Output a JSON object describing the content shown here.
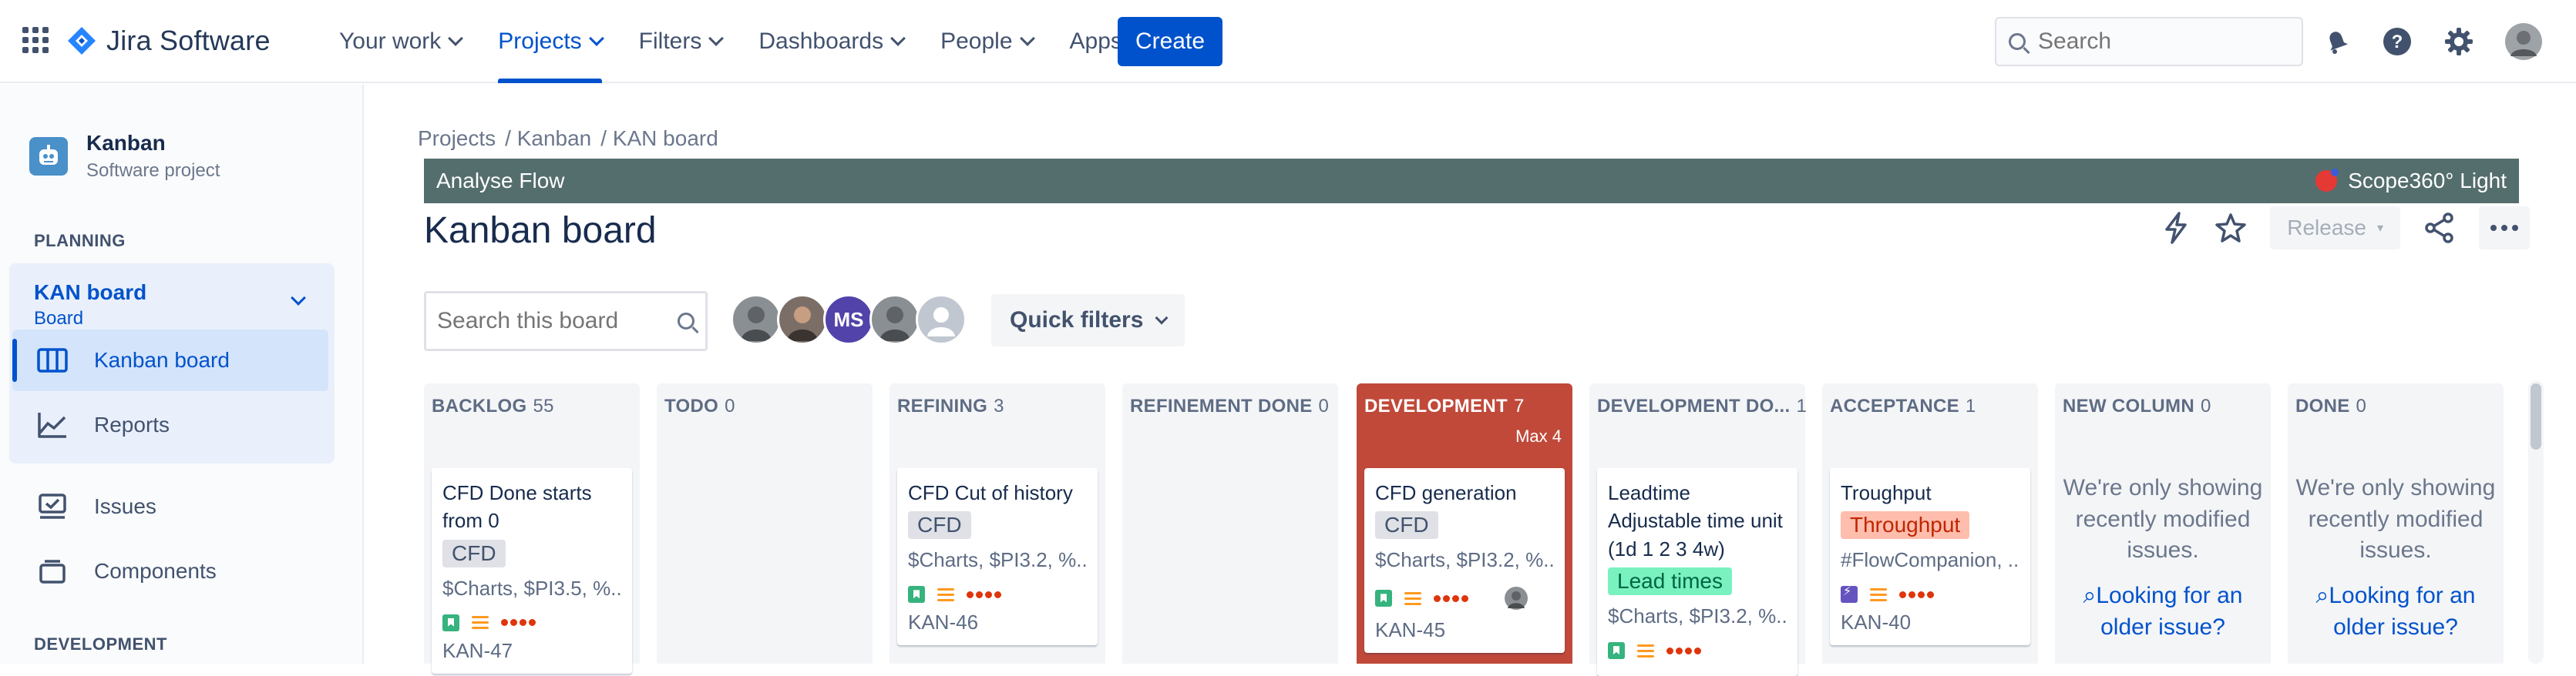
{
  "app": {
    "product": "Jira Software"
  },
  "nav": {
    "items": [
      {
        "label": "Your work",
        "active": false
      },
      {
        "label": "Projects",
        "active": true
      },
      {
        "label": "Filters",
        "active": false
      },
      {
        "label": "Dashboards",
        "active": false
      },
      {
        "label": "People",
        "active": false
      },
      {
        "label": "Apps",
        "active": false
      }
    ],
    "create_label": "Create",
    "search_placeholder": "Search"
  },
  "sidebar": {
    "project_name": "Kanban",
    "project_type": "Software project",
    "planning_heading": "PLANNING",
    "board_name": "KAN board",
    "board_sub": "Board",
    "items": [
      {
        "label": "Kanban board",
        "selected": true
      },
      {
        "label": "Reports",
        "selected": false
      },
      {
        "label": "Issues",
        "selected": false
      },
      {
        "label": "Components",
        "selected": false
      }
    ],
    "development_heading": "DEVELOPMENT"
  },
  "breadcrumb": [
    "Projects",
    "/ Kanban",
    "/ KAN board"
  ],
  "banner": {
    "left": "Analyse Flow",
    "right": "Scope360° Light"
  },
  "board": {
    "title": "Kanban board",
    "release_label": "Release",
    "search_placeholder": "Search this board",
    "avatar_initials": "MS",
    "quick_filters_label": "Quick filters",
    "columns": [
      {
        "name": "BACKLOG",
        "count": "55"
      },
      {
        "name": "TODO",
        "count": "0"
      },
      {
        "name": "REFINING",
        "count": "3"
      },
      {
        "name": "REFINEMENT DONE",
        "count": "0"
      },
      {
        "name": "DEVELOPMENT",
        "count": "7",
        "max": "Max 4"
      },
      {
        "name": "DEVELOPMENT DO...",
        "count": "1"
      },
      {
        "name": "ACCEPTANCE",
        "count": "1"
      },
      {
        "name": "NEW COLUMN",
        "count": "0"
      },
      {
        "name": "DONE",
        "count": "0"
      }
    ],
    "cards": {
      "backlog": {
        "title": "CFD Done starts from 0",
        "chip": "CFD",
        "labels": "$Charts, $PI3.5, %...",
        "key": "KAN-47"
      },
      "refining": {
        "title": "CFD Cut of history",
        "chip": "CFD",
        "labels": "$Charts, $PI3.2, %...",
        "key": "KAN-46"
      },
      "development": {
        "title": "CFD generation",
        "chip": "CFD",
        "labels": "$Charts, $PI3.2, %...",
        "key": "KAN-45"
      },
      "dev_done": {
        "title": "Leadtime Adjustable time unit (1d 1 2 3 4w)",
        "chip": "Lead times",
        "labels": "$Charts, $PI3.2, %..."
      },
      "acceptance": {
        "title": "Troughput",
        "chip": "Throughput",
        "labels": "#FlowCompanion, ...",
        "key": "KAN-40"
      }
    },
    "empty_message": "We're only showing recently modified issues.",
    "older_link": "Looking for an older issue?"
  },
  "colors": {
    "brand": "#0052cc",
    "banner": "#546e6d",
    "wip_exceeded": "#c0493a",
    "chip_cfd": "#dfe1e6",
    "chip_leadtimes": "#79f2c0",
    "chip_throughput": "#ffbdad"
  }
}
